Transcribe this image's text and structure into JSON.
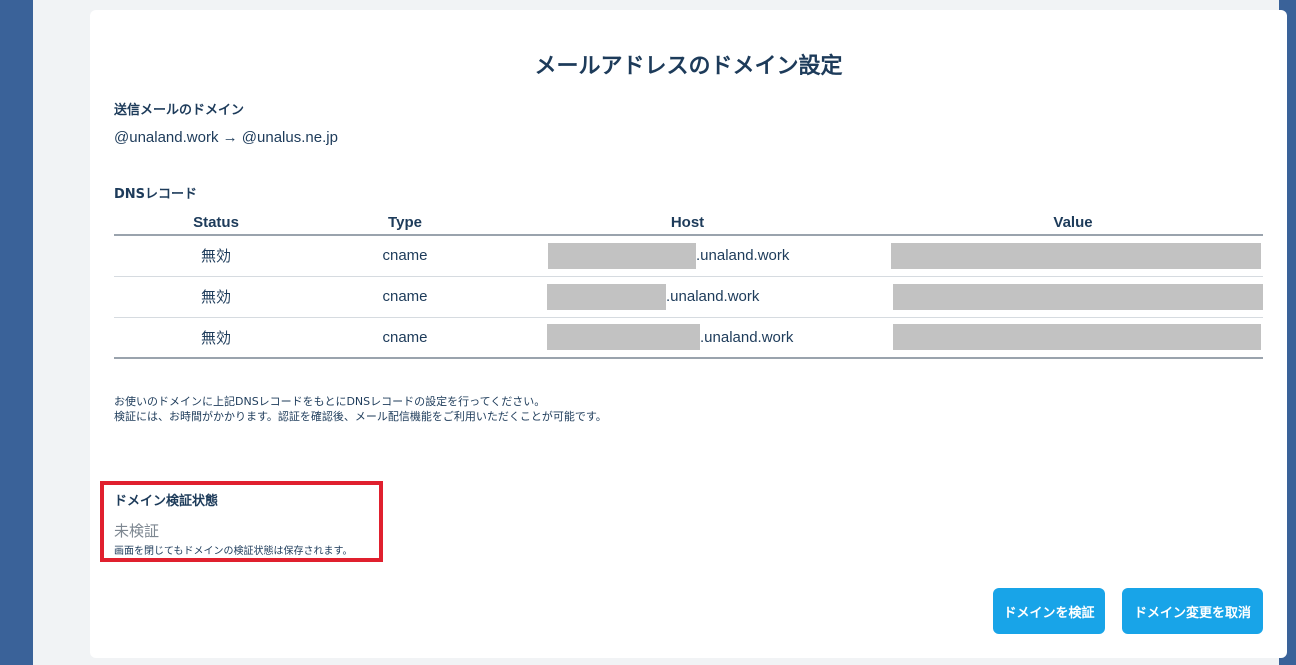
{
  "page": {
    "title": "メールアドレスのドメイン設定"
  },
  "sending_domain": {
    "label": "送信メールのドメイン",
    "value": "@unaland.work → @unalus.ne.jp"
  },
  "dns": {
    "label": "DNSレコード",
    "columns": [
      "Status",
      "Type",
      "Host",
      "Value"
    ],
    "rows": [
      {
        "status": "無効",
        "type": "cname",
        "host_suffix": ".unaland.work"
      },
      {
        "status": "無効",
        "type": "cname",
        "host_suffix": ".unaland.work"
      },
      {
        "status": "無効",
        "type": "cname",
        "host_suffix": ".unaland.work"
      }
    ]
  },
  "note": {
    "line1": "お使いのドメインに上記DNSレコードをもとにDNSレコードの設定を行ってください。",
    "line2": "検証には、お時間がかかります。認証を確認後、メール配信機能をご利用いただくことが可能です。"
  },
  "verification": {
    "label": "ドメイン検証状態",
    "state": "未検証",
    "note": "画面を閉じてもドメインの検証状態は保存されます。"
  },
  "buttons": {
    "verify": "ドメインを検証",
    "cancel": "ドメイン変更を取消"
  },
  "colors": {
    "primary_button": "#18a4e8",
    "highlight_border": "#e0202e",
    "text": "#1d3b5a",
    "redacted": "#c2c2c2"
  }
}
